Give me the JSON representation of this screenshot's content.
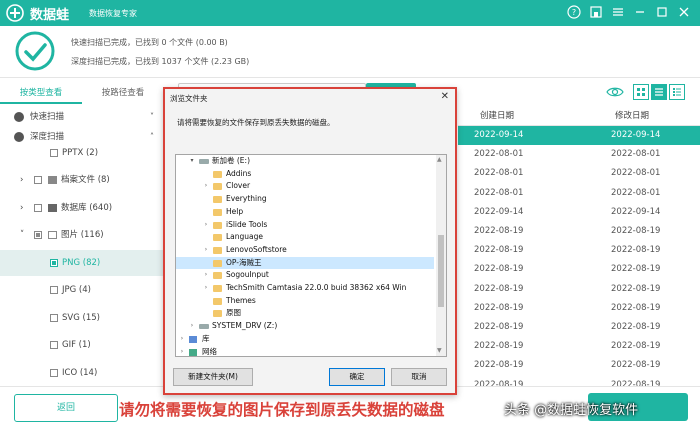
{
  "app": {
    "brand": "数据蛙",
    "slogan": "数据恢复专家"
  },
  "scan": {
    "quick": "快速扫描已完成，已找到 0 个文件 (0.00  B)",
    "deep": "深度扫描已完成，已找到 1037 个文件 (2.23 GB)"
  },
  "tabs": [
    "按类型查看",
    "按路径查看"
  ],
  "sidebar": [
    {
      "label": "快速扫描",
      "kind": "section"
    },
    {
      "label": "深度扫描",
      "kind": "section"
    },
    {
      "label": "PPTX (2)",
      "kind": "sub"
    },
    {
      "label": "档案文件 (8)",
      "kind": "group"
    },
    {
      "label": "数据库 (640)",
      "kind": "group"
    },
    {
      "label": "图片 (116)",
      "kind": "group-open"
    },
    {
      "label": "PNG (82)",
      "kind": "sub-active"
    },
    {
      "label": "JPG (4)",
      "kind": "sub"
    },
    {
      "label": "SVG (15)",
      "kind": "sub"
    },
    {
      "label": "GIF (1)",
      "kind": "sub"
    },
    {
      "label": "ICO (14)",
      "kind": "sub"
    }
  ],
  "table": {
    "headers": [
      "创建日期",
      "修改日期"
    ],
    "rows": [
      [
        "2022-09-14",
        "2022-09-14"
      ],
      [
        "2022-08-01",
        "2022-08-01"
      ],
      [
        "2022-08-01",
        "2022-08-01"
      ],
      [
        "2022-08-01",
        "2022-08-01"
      ],
      [
        "2022-09-14",
        "2022-09-14"
      ],
      [
        "2022-08-19",
        "2022-08-19"
      ],
      [
        "2022-08-19",
        "2022-08-19"
      ],
      [
        "2022-08-19",
        "2022-08-19"
      ],
      [
        "2022-08-19",
        "2022-08-19"
      ],
      [
        "2022-08-19",
        "2022-08-19"
      ],
      [
        "2022-08-19",
        "2022-08-19"
      ],
      [
        "2022-08-19",
        "2022-08-19"
      ],
      [
        "2022-08-19",
        "2022-08-19"
      ],
      [
        "2022-08-19",
        "2022-08-19"
      ]
    ]
  },
  "back_label": "返回",
  "dialog": {
    "title": "浏览文件夹",
    "message": "请将需要恢复的文件保存到原丢失数据的磁盘。",
    "tree": [
      {
        "label": "新加卷 (E:)",
        "depth": 0,
        "expand": "open",
        "icon": "drive"
      },
      {
        "label": "Addins",
        "depth": 1,
        "expand": "",
        "icon": "folder"
      },
      {
        "label": "Clover",
        "depth": 1,
        "expand": "closed",
        "icon": "folder"
      },
      {
        "label": "Everything",
        "depth": 1,
        "expand": "",
        "icon": "folder"
      },
      {
        "label": "Help",
        "depth": 1,
        "expand": "",
        "icon": "folder"
      },
      {
        "label": "iSlide Tools",
        "depth": 1,
        "expand": "closed",
        "icon": "folder"
      },
      {
        "label": "Language",
        "depth": 1,
        "expand": "",
        "icon": "folder"
      },
      {
        "label": "LenovoSoftstore",
        "depth": 1,
        "expand": "closed",
        "icon": "folder"
      },
      {
        "label": "OP-海贼王",
        "depth": 1,
        "expand": "",
        "icon": "folder",
        "selected": true
      },
      {
        "label": "SogouInput",
        "depth": 1,
        "expand": "closed",
        "icon": "folder"
      },
      {
        "label": "TechSmith Camtasia 22.0.0 buid 38362 x64 Win",
        "depth": 1,
        "expand": "closed",
        "icon": "folder"
      },
      {
        "label": "Themes",
        "depth": 1,
        "expand": "",
        "icon": "folder"
      },
      {
        "label": "原图",
        "depth": 1,
        "expand": "",
        "icon": "folder"
      },
      {
        "label": "SYSTEM_DRV (Z:)",
        "depth": 0,
        "expand": "closed",
        "icon": "drive"
      },
      {
        "label": "库",
        "depth": -1,
        "expand": "closed",
        "icon": "library"
      },
      {
        "label": "网络",
        "depth": -1,
        "expand": "closed",
        "icon": "network"
      }
    ],
    "new_folder": "新建文件夹(M)",
    "ok": "确定",
    "cancel": "取消"
  },
  "caption": "请勿将需要恢复的图片保存到原丢失数据的磁盘",
  "watermark": "头条 @数据蛙恢复软件",
  "colors": {
    "accent": "#1fb5a2",
    "warning": "#d9423a"
  }
}
